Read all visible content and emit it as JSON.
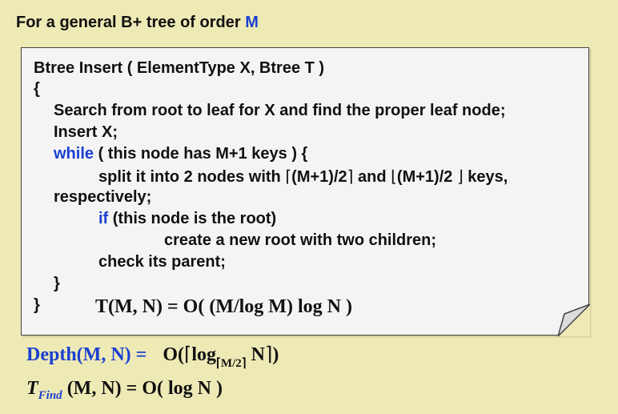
{
  "heading": {
    "text": "For a general B+ tree of order ",
    "order_var": "M"
  },
  "code": {
    "signature": "Btree  Insert ( ElementType X,  Btree T )",
    "open_brace": "{",
    "line_search": "Search from root to leaf for X and find the proper leaf node;",
    "line_insert": "Insert X;",
    "while_kw": "while",
    "while_cond": " ( this node has M+1 keys ) {",
    "split_pre": "split it into 2 nodes with ",
    "split_ceil": "(M+1)/2",
    "split_mid": " and ",
    "split_floor": "(M+1)/2",
    "split_post": " keys,",
    "respectively": "respectively;",
    "if_kw": "if",
    "if_cond": " (this node is the root)",
    "create_root": "create a new root with two children;",
    "check_parent": "check its parent;",
    "close_inner": "}",
    "close_outer": "}"
  },
  "formulas": {
    "insert_time": "T(M, N) = O( (M/log M) log N )",
    "depth_label": "Depth(M, N) =",
    "depth_o": "O(",
    "depth_log": "log",
    "depth_base": "M/2",
    "depth_n": "N",
    "depth_close": ")",
    "find_t": "T",
    "find_sub": "Find",
    "find_rest": "(M, N) = O( log N )"
  },
  "colors": {
    "background": "#eeeab6",
    "keyword": "#1a3fd0",
    "box": "#f4f4f4"
  }
}
